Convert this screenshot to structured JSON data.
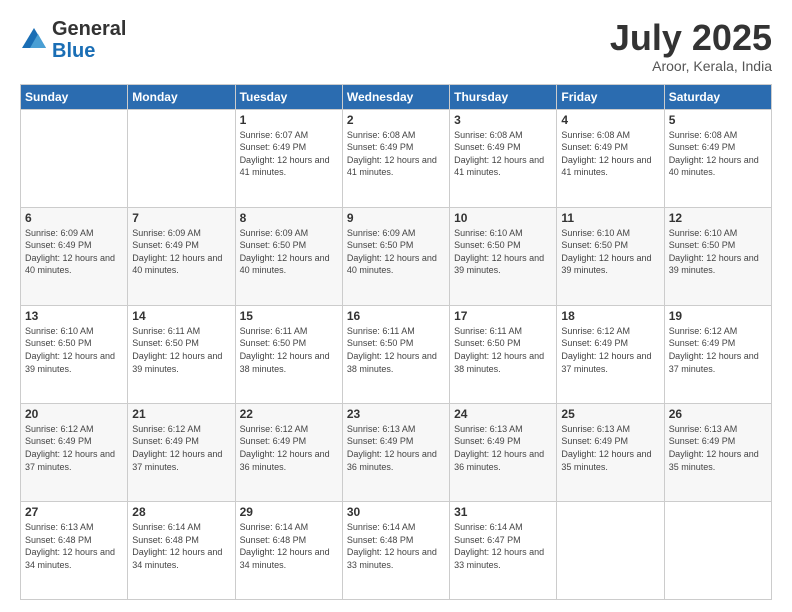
{
  "logo": {
    "general": "General",
    "blue": "Blue"
  },
  "title": {
    "month": "July 2025",
    "location": "Aroor, Kerala, India"
  },
  "days_of_week": [
    "Sunday",
    "Monday",
    "Tuesday",
    "Wednesday",
    "Thursday",
    "Friday",
    "Saturday"
  ],
  "weeks": [
    [
      {
        "day": "",
        "info": ""
      },
      {
        "day": "",
        "info": ""
      },
      {
        "day": "1",
        "info": "Sunrise: 6:07 AM\nSunset: 6:49 PM\nDaylight: 12 hours and 41 minutes."
      },
      {
        "day": "2",
        "info": "Sunrise: 6:08 AM\nSunset: 6:49 PM\nDaylight: 12 hours and 41 minutes."
      },
      {
        "day": "3",
        "info": "Sunrise: 6:08 AM\nSunset: 6:49 PM\nDaylight: 12 hours and 41 minutes."
      },
      {
        "day": "4",
        "info": "Sunrise: 6:08 AM\nSunset: 6:49 PM\nDaylight: 12 hours and 41 minutes."
      },
      {
        "day": "5",
        "info": "Sunrise: 6:08 AM\nSunset: 6:49 PM\nDaylight: 12 hours and 40 minutes."
      }
    ],
    [
      {
        "day": "6",
        "info": "Sunrise: 6:09 AM\nSunset: 6:49 PM\nDaylight: 12 hours and 40 minutes."
      },
      {
        "day": "7",
        "info": "Sunrise: 6:09 AM\nSunset: 6:49 PM\nDaylight: 12 hours and 40 minutes."
      },
      {
        "day": "8",
        "info": "Sunrise: 6:09 AM\nSunset: 6:50 PM\nDaylight: 12 hours and 40 minutes."
      },
      {
        "day": "9",
        "info": "Sunrise: 6:09 AM\nSunset: 6:50 PM\nDaylight: 12 hours and 40 minutes."
      },
      {
        "day": "10",
        "info": "Sunrise: 6:10 AM\nSunset: 6:50 PM\nDaylight: 12 hours and 39 minutes."
      },
      {
        "day": "11",
        "info": "Sunrise: 6:10 AM\nSunset: 6:50 PM\nDaylight: 12 hours and 39 minutes."
      },
      {
        "day": "12",
        "info": "Sunrise: 6:10 AM\nSunset: 6:50 PM\nDaylight: 12 hours and 39 minutes."
      }
    ],
    [
      {
        "day": "13",
        "info": "Sunrise: 6:10 AM\nSunset: 6:50 PM\nDaylight: 12 hours and 39 minutes."
      },
      {
        "day": "14",
        "info": "Sunrise: 6:11 AM\nSunset: 6:50 PM\nDaylight: 12 hours and 39 minutes."
      },
      {
        "day": "15",
        "info": "Sunrise: 6:11 AM\nSunset: 6:50 PM\nDaylight: 12 hours and 38 minutes."
      },
      {
        "day": "16",
        "info": "Sunrise: 6:11 AM\nSunset: 6:50 PM\nDaylight: 12 hours and 38 minutes."
      },
      {
        "day": "17",
        "info": "Sunrise: 6:11 AM\nSunset: 6:50 PM\nDaylight: 12 hours and 38 minutes."
      },
      {
        "day": "18",
        "info": "Sunrise: 6:12 AM\nSunset: 6:49 PM\nDaylight: 12 hours and 37 minutes."
      },
      {
        "day": "19",
        "info": "Sunrise: 6:12 AM\nSunset: 6:49 PM\nDaylight: 12 hours and 37 minutes."
      }
    ],
    [
      {
        "day": "20",
        "info": "Sunrise: 6:12 AM\nSunset: 6:49 PM\nDaylight: 12 hours and 37 minutes."
      },
      {
        "day": "21",
        "info": "Sunrise: 6:12 AM\nSunset: 6:49 PM\nDaylight: 12 hours and 37 minutes."
      },
      {
        "day": "22",
        "info": "Sunrise: 6:12 AM\nSunset: 6:49 PM\nDaylight: 12 hours and 36 minutes."
      },
      {
        "day": "23",
        "info": "Sunrise: 6:13 AM\nSunset: 6:49 PM\nDaylight: 12 hours and 36 minutes."
      },
      {
        "day": "24",
        "info": "Sunrise: 6:13 AM\nSunset: 6:49 PM\nDaylight: 12 hours and 36 minutes."
      },
      {
        "day": "25",
        "info": "Sunrise: 6:13 AM\nSunset: 6:49 PM\nDaylight: 12 hours and 35 minutes."
      },
      {
        "day": "26",
        "info": "Sunrise: 6:13 AM\nSunset: 6:49 PM\nDaylight: 12 hours and 35 minutes."
      }
    ],
    [
      {
        "day": "27",
        "info": "Sunrise: 6:13 AM\nSunset: 6:48 PM\nDaylight: 12 hours and 34 minutes."
      },
      {
        "day": "28",
        "info": "Sunrise: 6:14 AM\nSunset: 6:48 PM\nDaylight: 12 hours and 34 minutes."
      },
      {
        "day": "29",
        "info": "Sunrise: 6:14 AM\nSunset: 6:48 PM\nDaylight: 12 hours and 34 minutes."
      },
      {
        "day": "30",
        "info": "Sunrise: 6:14 AM\nSunset: 6:48 PM\nDaylight: 12 hours and 33 minutes."
      },
      {
        "day": "31",
        "info": "Sunrise: 6:14 AM\nSunset: 6:47 PM\nDaylight: 12 hours and 33 minutes."
      },
      {
        "day": "",
        "info": ""
      },
      {
        "day": "",
        "info": ""
      }
    ]
  ]
}
